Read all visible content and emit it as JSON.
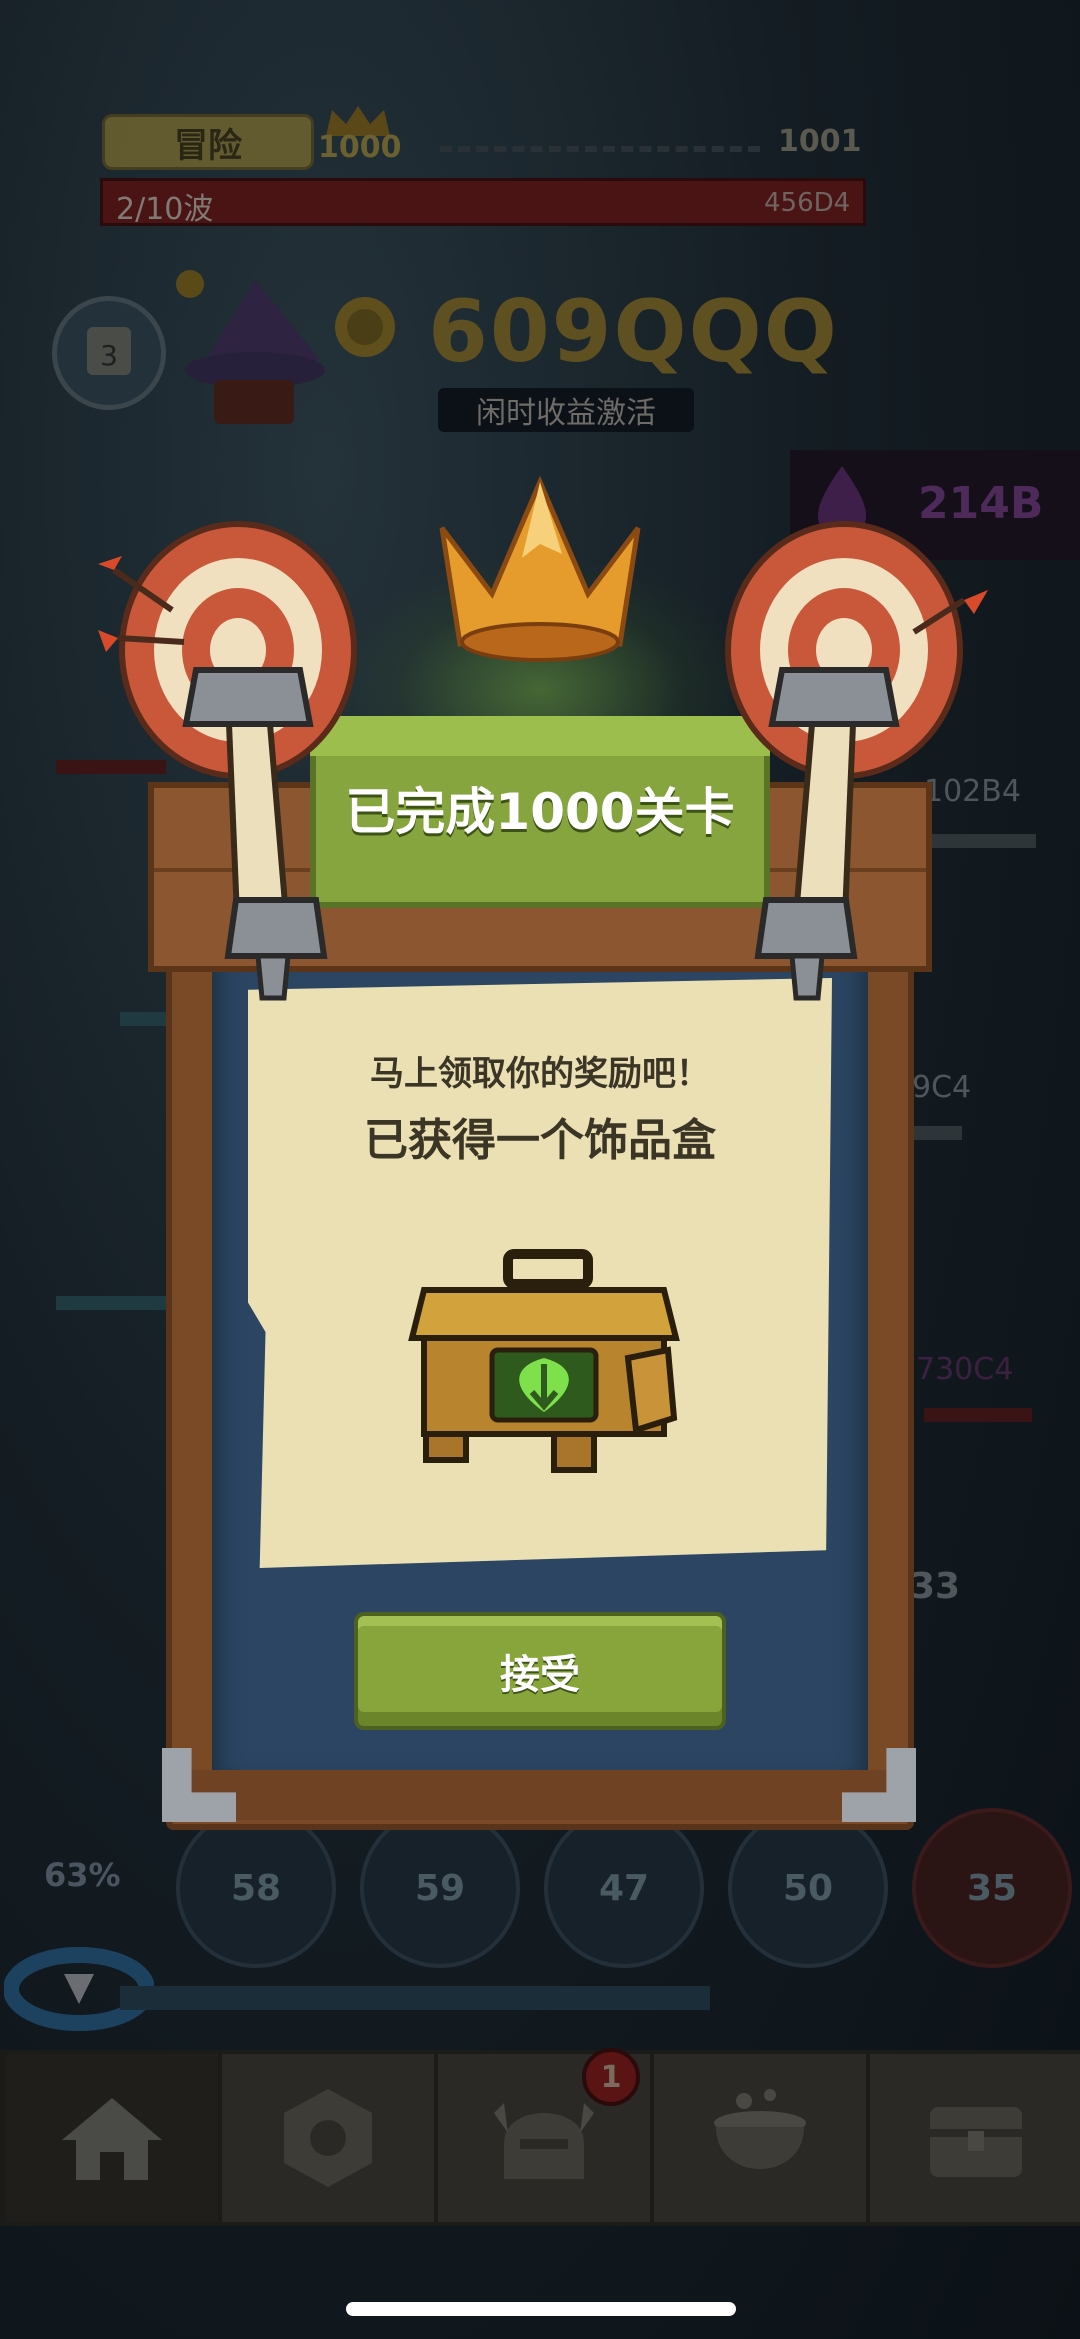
{
  "hud": {
    "mode_label": "冒险",
    "level_current": "1000",
    "level_next": "1001",
    "wave_label": "2/10波",
    "wave_value": "456D4",
    "gold_amount": "609QQQ",
    "idle_label": "闲时收益激活",
    "gem_amount": "214B",
    "side_values": [
      "102B4",
      "9C4",
      "730C4",
      "33"
    ]
  },
  "skills": {
    "percent": "63%",
    "levels": [
      "58",
      "59",
      "47",
      "50",
      "35"
    ]
  },
  "nav": {
    "badge_count": "1",
    "tabs": [
      "home-icon",
      "gear-icon",
      "helmet-icon",
      "cauldron-icon",
      "chest-icon"
    ]
  },
  "modal": {
    "title": "已完成1000关卡",
    "message_line1": "马上领取你的奖励吧！",
    "message_line2": "已获得一个饰品盒",
    "reward_icon": "accessory-box-icon",
    "accept_label": "接受"
  },
  "colors": {
    "sign_green": "#86a53e",
    "button_green": "#88a53b",
    "board_wood": "#7a4a26",
    "board_blue": "#2b4562",
    "paper": "#ebdfb4"
  }
}
